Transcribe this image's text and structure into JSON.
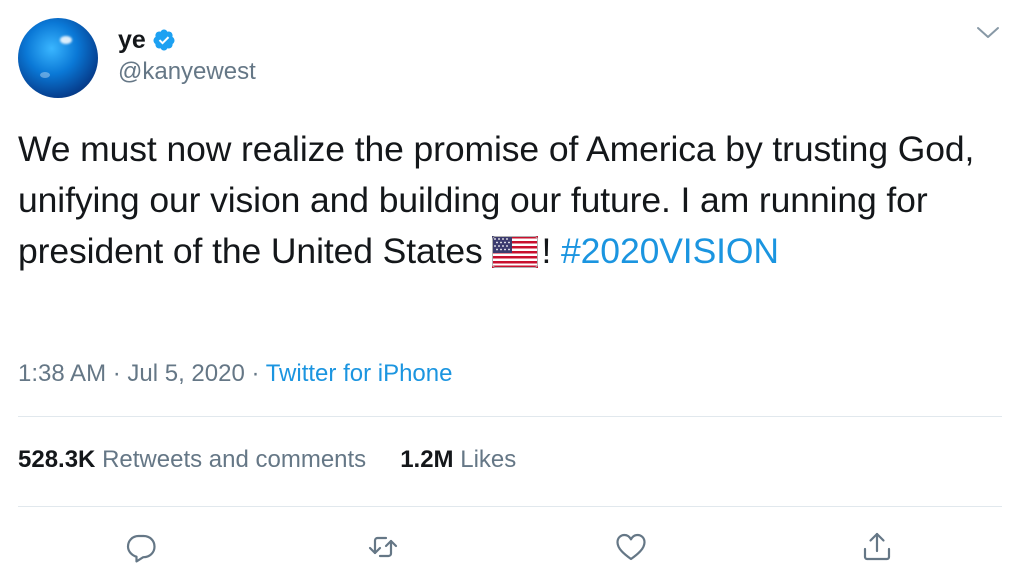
{
  "author": {
    "display_name": "ye",
    "handle": "@kanyewest",
    "verified": true,
    "avatar_icon": "blue-globe-avatar"
  },
  "tweet": {
    "text_before_flag": "We must now realize the promise of America by trusting God, unifying our vision and building our future. I am running for president of the United States ",
    "flag_icon": "us-flag-emoji",
    "text_after_flag": "! ",
    "hashtag": "#2020VISION"
  },
  "meta": {
    "time": "1:38 AM",
    "separator": " · ",
    "date": "Jul 5, 2020",
    "source": "Twitter for iPhone"
  },
  "stats": {
    "retweets_count": "528.3K",
    "retweets_label": "Retweets and comments",
    "likes_count": "1.2M",
    "likes_label": "Likes"
  },
  "actions": {
    "reply_icon": "reply-icon",
    "retweet_icon": "retweet-icon",
    "like_icon": "heart-icon",
    "share_icon": "share-icon"
  },
  "colors": {
    "accent": "#1b95e0",
    "secondary_text": "#657786",
    "primary_text": "#14171a",
    "divider": "#e1e8ed"
  }
}
